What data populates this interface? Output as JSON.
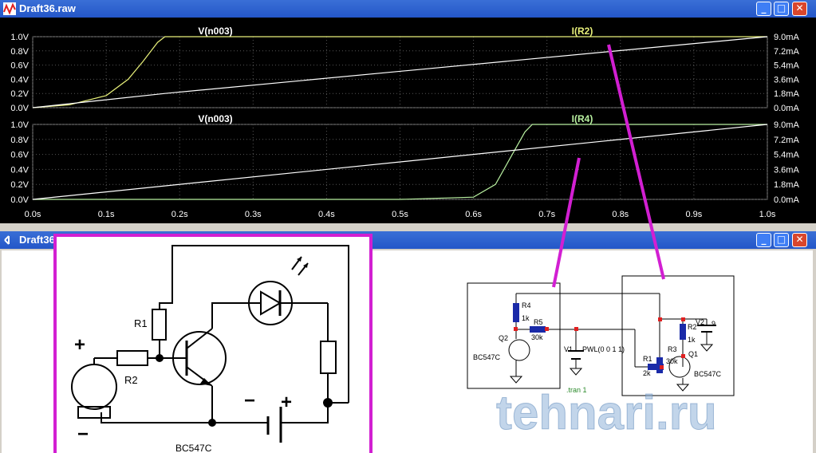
{
  "waveform_window": {
    "title": "Draft36.raw"
  },
  "schematic_window": {
    "title": "Draft36"
  },
  "chart_data": [
    {
      "type": "line",
      "traces": [
        "V(n003)",
        "I(R2)"
      ],
      "series": [
        {
          "name": "V(n003)",
          "axis": "left",
          "x": [
            0,
            0.05,
            0.1,
            0.13,
            0.15,
            0.17,
            0.18,
            1.0
          ],
          "values": [
            0,
            0.04,
            0.17,
            0.4,
            0.65,
            0.92,
            1.0,
            1.0
          ]
        },
        {
          "name": "I(R2)",
          "axis": "right",
          "x": [
            0,
            0.18,
            1.0
          ],
          "values": [
            0,
            1.8,
            9.0
          ]
        }
      ],
      "left_ticks": [
        "1.0V",
        "0.8V",
        "0.6V",
        "0.4V",
        "0.2V",
        "0.0V"
      ],
      "right_ticks": [
        "9.0mA",
        "7.2mA",
        "5.4mA",
        "3.6mA",
        "1.8mA",
        "0.0mA"
      ],
      "ylim_left": [
        0,
        1.0
      ],
      "ylim_right": [
        0,
        9.0
      ]
    },
    {
      "type": "line",
      "traces": [
        "V(n003)",
        "I(R4)"
      ],
      "series": [
        {
          "name": "V(n003)",
          "axis": "left",
          "x": [
            0,
            0.5,
            0.6,
            0.63,
            0.65,
            0.67,
            0.68,
            1.0
          ],
          "values": [
            0,
            0.0,
            0.03,
            0.2,
            0.55,
            0.9,
            1.0,
            1.0
          ]
        },
        {
          "name": "I(R4)",
          "axis": "right",
          "x": [
            0,
            1.0
          ],
          "values": [
            0,
            9.0
          ]
        }
      ],
      "left_ticks": [
        "1.0V",
        "0.8V",
        "0.6V",
        "0.4V",
        "0.2V",
        "0.0V"
      ],
      "right_ticks": [
        "9.0mA",
        "7.2mA",
        "5.4mA",
        "3.6mA",
        "1.8mA",
        "0.0mA"
      ],
      "ylim_left": [
        0,
        1.0
      ],
      "ylim_right": [
        0,
        9.0
      ],
      "x_ticks": [
        "0.0s",
        "0.1s",
        "0.2s",
        "0.3s",
        "0.4s",
        "0.5s",
        "0.6s",
        "0.7s",
        "0.8s",
        "0.9s",
        "1.0s"
      ],
      "xlim": [
        0,
        1.0
      ]
    }
  ],
  "hand_drawing": {
    "labels": [
      "R1",
      "R2",
      "+",
      "−",
      "BC547C"
    ]
  },
  "ltspice_schematic": {
    "left": {
      "labels": [
        "R4",
        "1k",
        "R5",
        "30k",
        "Q2",
        "BC547C"
      ]
    },
    "middle": {
      "labels": [
        "V1",
        "PWL(0 0 1 1)",
        ".tran 1"
      ]
    },
    "right": {
      "labels": [
        "V2",
        "9",
        "R2",
        "1k",
        "R3",
        "30k",
        "Q1",
        "R1",
        "2k",
        "BC547C"
      ]
    }
  },
  "watermark": "tehnari.ru",
  "colors": {
    "titlebar": "#2456c8",
    "trace_voltage": "#e8f07a",
    "trace_current": "#ffffff",
    "annotation": "#d21fd2",
    "trace_current_r4": "#b8f0a0"
  }
}
